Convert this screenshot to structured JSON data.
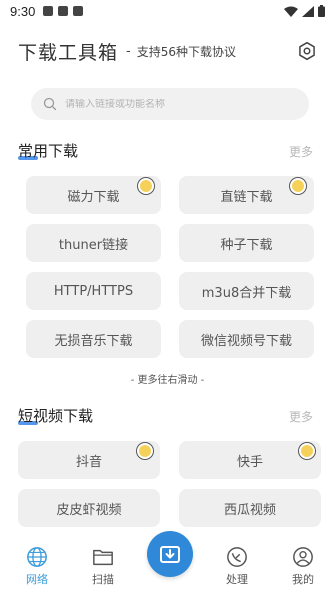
{
  "status_bar": {
    "time": "9:30"
  },
  "header": {
    "title": "下载工具箱",
    "dash": "-",
    "subtitle": "支持56种下载协议"
  },
  "search": {
    "placeholder": "请输入链接或功能名称"
  },
  "common": {
    "title": "常用下载",
    "more": "更多",
    "items": [
      "磁力下载",
      "直链下载",
      "thuner链接",
      "种子下载",
      "HTTP/HTTPS",
      "m3u8合并下载",
      "无损音乐下载",
      "微信视频号下载"
    ]
  },
  "hint": "- 更多往右滑动 -",
  "video": {
    "title": "短视频下载",
    "more": "更多",
    "items": [
      "抖音",
      "快手",
      "皮皮虾视频",
      "西瓜视频"
    ]
  },
  "tabs": [
    {
      "label": "网络",
      "icon": "globe-icon",
      "active": true
    },
    {
      "label": "扫描",
      "icon": "folder-icon"
    },
    {
      "label": "处理",
      "icon": "satellite-icon"
    },
    {
      "label": "我的",
      "icon": "user-icon"
    }
  ],
  "colors": {
    "accent": "#2f88d8",
    "active_tab": "#3a9bd9",
    "badge": "#f5d15a"
  }
}
